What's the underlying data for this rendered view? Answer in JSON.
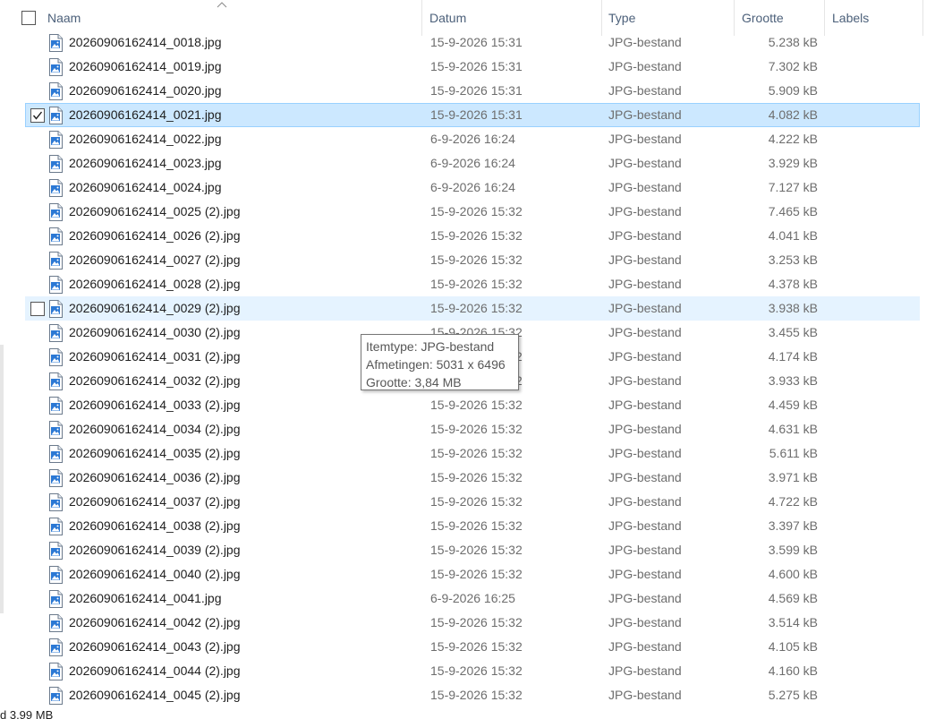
{
  "columns": {
    "name": "Naam",
    "date": "Datum",
    "type": "Type",
    "size": "Grootte",
    "labels": "Labels"
  },
  "icons": {
    "file": "jpg-file-icon",
    "sort": "sort-ascending-icon",
    "check": "checkmark-icon"
  },
  "colors": {
    "selected_bg": "#cce8ff",
    "selected_border": "#99d1ff",
    "hover_bg": "#e5f3ff",
    "header_text": "#4c607a",
    "muted_text": "#6d6d6d"
  },
  "files": [
    {
      "name": "20260906162414_0018.jpg",
      "date": "15-9-2026 15:31",
      "type": "JPG-bestand",
      "size": "5.238 kB",
      "state": "normal"
    },
    {
      "name": "20260906162414_0019.jpg",
      "date": "15-9-2026 15:31",
      "type": "JPG-bestand",
      "size": "7.302 kB",
      "state": "normal"
    },
    {
      "name": "20260906162414_0020.jpg",
      "date": "15-9-2026 15:31",
      "type": "JPG-bestand",
      "size": "5.909 kB",
      "state": "normal"
    },
    {
      "name": "20260906162414_0021.jpg",
      "date": "15-9-2026 15:31",
      "type": "JPG-bestand",
      "size": "4.082 kB",
      "state": "selected"
    },
    {
      "name": "20260906162414_0022.jpg",
      "date": "6-9-2026 16:24",
      "type": "JPG-bestand",
      "size": "4.222 kB",
      "state": "normal"
    },
    {
      "name": "20260906162414_0023.jpg",
      "date": "6-9-2026 16:24",
      "type": "JPG-bestand",
      "size": "3.929 kB",
      "state": "normal"
    },
    {
      "name": "20260906162414_0024.jpg",
      "date": "6-9-2026 16:24",
      "type": "JPG-bestand",
      "size": "7.127 kB",
      "state": "normal"
    },
    {
      "name": "20260906162414_0025 (2).jpg",
      "date": "15-9-2026 15:32",
      "type": "JPG-bestand",
      "size": "7.465 kB",
      "state": "normal"
    },
    {
      "name": "20260906162414_0026 (2).jpg",
      "date": "15-9-2026 15:32",
      "type": "JPG-bestand",
      "size": "4.041 kB",
      "state": "normal"
    },
    {
      "name": "20260906162414_0027 (2).jpg",
      "date": "15-9-2026 15:32",
      "type": "JPG-bestand",
      "size": "3.253 kB",
      "state": "normal"
    },
    {
      "name": "20260906162414_0028 (2).jpg",
      "date": "15-9-2026 15:32",
      "type": "JPG-bestand",
      "size": "4.378 kB",
      "state": "normal"
    },
    {
      "name": "20260906162414_0029 (2).jpg",
      "date": "15-9-2026 15:32",
      "type": "JPG-bestand",
      "size": "3.938 kB",
      "state": "hover"
    },
    {
      "name": "20260906162414_0030 (2).jpg",
      "date": "15-9-2026 15:32",
      "type": "JPG-bestand",
      "size": "3.455 kB",
      "state": "normal"
    },
    {
      "name": "20260906162414_0031 (2).jpg",
      "date": "15-9-2026 15:32",
      "type": "JPG-bestand",
      "size": "4.174 kB",
      "state": "normal"
    },
    {
      "name": "20260906162414_0032 (2).jpg",
      "date": "15-9-2026 15:32",
      "type": "JPG-bestand",
      "size": "3.933 kB",
      "state": "normal"
    },
    {
      "name": "20260906162414_0033 (2).jpg",
      "date": "15-9-2026 15:32",
      "type": "JPG-bestand",
      "size": "4.459 kB",
      "state": "normal"
    },
    {
      "name": "20260906162414_0034 (2).jpg",
      "date": "15-9-2026 15:32",
      "type": "JPG-bestand",
      "size": "4.631 kB",
      "state": "normal"
    },
    {
      "name": "20260906162414_0035 (2).jpg",
      "date": "15-9-2026 15:32",
      "type": "JPG-bestand",
      "size": "5.611 kB",
      "state": "normal"
    },
    {
      "name": "20260906162414_0036 (2).jpg",
      "date": "15-9-2026 15:32",
      "type": "JPG-bestand",
      "size": "3.971 kB",
      "state": "normal"
    },
    {
      "name": "20260906162414_0037 (2).jpg",
      "date": "15-9-2026 15:32",
      "type": "JPG-bestand",
      "size": "4.722 kB",
      "state": "normal"
    },
    {
      "name": "20260906162414_0038 (2).jpg",
      "date": "15-9-2026 15:32",
      "type": "JPG-bestand",
      "size": "3.397 kB",
      "state": "normal"
    },
    {
      "name": "20260906162414_0039 (2).jpg",
      "date": "15-9-2026 15:32",
      "type": "JPG-bestand",
      "size": "3.599 kB",
      "state": "normal"
    },
    {
      "name": "20260906162414_0040 (2).jpg",
      "date": "15-9-2026 15:32",
      "type": "JPG-bestand",
      "size": "4.600 kB",
      "state": "normal"
    },
    {
      "name": "20260906162414_0041.jpg",
      "date": "6-9-2026 16:25",
      "type": "JPG-bestand",
      "size": "4.569 kB",
      "state": "normal"
    },
    {
      "name": "20260906162414_0042 (2).jpg",
      "date": "15-9-2026 15:32",
      "type": "JPG-bestand",
      "size": "3.514 kB",
      "state": "normal"
    },
    {
      "name": "20260906162414_0043 (2).jpg",
      "date": "15-9-2026 15:32",
      "type": "JPG-bestand",
      "size": "4.105 kB",
      "state": "normal"
    },
    {
      "name": "20260906162414_0044 (2).jpg",
      "date": "15-9-2026 15:32",
      "type": "JPG-bestand",
      "size": "4.160 kB",
      "state": "normal"
    },
    {
      "name": "20260906162414_0045 (2).jpg",
      "date": "15-9-2026 15:32",
      "type": "JPG-bestand",
      "size": "5.275 kB",
      "state": "normal"
    }
  ],
  "tooltip": {
    "itemtype": "Itemtype: JPG-bestand",
    "dimensions": "Afmetingen: 5031 x 6496",
    "size": "Grootte: 3,84 MB"
  },
  "status_bar": {
    "text": "d  3,99 MB"
  }
}
